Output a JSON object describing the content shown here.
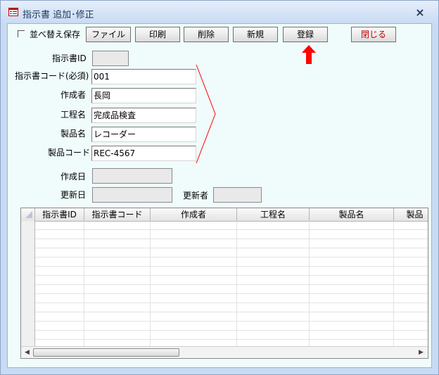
{
  "window": {
    "title": "指示書 追加･修正",
    "icon": "form-icon",
    "close_glyph": "×"
  },
  "toolbar": {
    "sort_save_label": "並べ替え保存",
    "file_label": "ファイル",
    "print_label": "印刷",
    "delete_label": "削除",
    "new_label": "新規",
    "register_label": "登録",
    "close_label": "閉じる"
  },
  "form": {
    "id_label": "指示書ID",
    "id_value": "",
    "code_label": "指示書コード(必須)",
    "code_value": "001",
    "author_label": "作成者",
    "author_value": "長岡",
    "process_label": "工程名",
    "process_value": "完成品検査",
    "product_label": "製品名",
    "product_value": "レコーダー",
    "product_code_label": "製品コード",
    "product_code_value": "REC-4567",
    "created_label": "作成日",
    "created_value": "",
    "updated_label": "更新日",
    "updated_value": "",
    "updater_label": "更新者",
    "updater_value": ""
  },
  "grid": {
    "columns": [
      "指示書ID",
      "指示書コード",
      "作成者",
      "工程名",
      "製品名",
      "製品"
    ]
  },
  "colors": {
    "accent_arrow": "#ff0000",
    "bracket": "#ff0000",
    "close_text": "#c00000",
    "client_bg": "#f0fbfb"
  }
}
